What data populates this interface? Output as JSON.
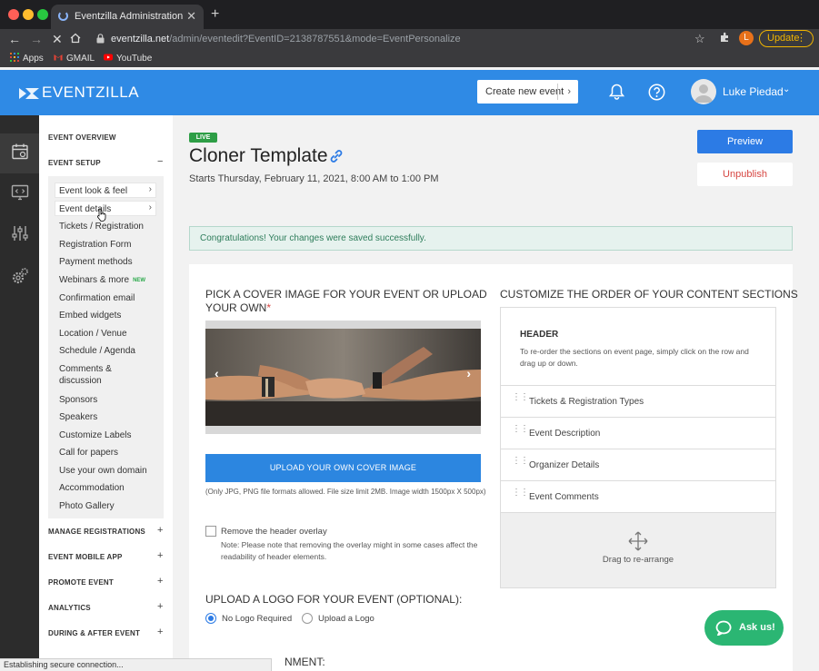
{
  "browser": {
    "tab_title": "Eventzilla Administration",
    "url_host": "eventzilla.net",
    "url_path": "/admin/eventedit?EventID=2138787551&mode=EventPersonalize",
    "profile_initial": "L",
    "update_label": "Update",
    "bookmarks": [
      "Apps",
      "GMAIL",
      "YouTube"
    ],
    "status_text": "Establishing secure connection..."
  },
  "header": {
    "logo_text": "EVENTZILLA",
    "create_event_label": "Create new event",
    "user_name": "Luke Piedad",
    "brand_color": "#2f8ae5"
  },
  "sidebar": {
    "event_overview": "EVENT OVERVIEW",
    "event_setup": "EVENT SETUP",
    "event_setup_toggle": "−",
    "setup_items": [
      "Event look & feel",
      "Event details",
      "Tickets / Registration",
      "Registration Form",
      "Payment methods",
      "Webinars & more",
      "Confirmation email",
      "Embed widgets",
      "Location / Venue",
      "Schedule / Agenda",
      "Comments & discussion",
      "Sponsors",
      "Speakers",
      "Customize Labels",
      "Call for papers",
      "Use your own domain",
      "Accommodation",
      "Photo Gallery"
    ],
    "new_badge": "NEW",
    "sections": [
      {
        "label": "MANAGE REGISTRATIONS",
        "toggle": "+"
      },
      {
        "label": "EVENT MOBILE APP",
        "toggle": "+"
      },
      {
        "label": "PROMOTE EVENT",
        "toggle": "+"
      },
      {
        "label": "ANALYTICS",
        "toggle": "+"
      },
      {
        "label": "DURING & AFTER EVENT",
        "toggle": "+"
      }
    ]
  },
  "event": {
    "status_badge": "LIVE",
    "title": "Cloner Template",
    "date": "Starts Thursday, February 11, 2021, 8:00 AM to 1:00 PM",
    "preview_label": "Preview",
    "unpublish_label": "Unpublish",
    "success_message": "Congratulations! Your changes were saved successfully."
  },
  "cover": {
    "heading": "PICK A COVER IMAGE FOR YOUR EVENT OR UPLOAD YOUR OWN",
    "required_mark": "*",
    "prev_arrow": "‹",
    "next_arrow": "›",
    "upload_label": "UPLOAD YOUR OWN COVER IMAGE",
    "upload_note": "(Only JPG, PNG file formats allowed. File size limit 2MB. Image width 1500px X 500px)",
    "remove_overlay_label": "Remove the header overlay",
    "remove_overlay_checked": false,
    "remove_overlay_note": "Note: Please note that removing the overlay might in some cases affect the readability of header elements."
  },
  "logo_section": {
    "heading": "UPLOAD A LOGO FOR YOUR EVENT (OPTIONAL):",
    "options": [
      "No Logo Required",
      "Upload a Logo"
    ],
    "selected": "No Logo Required"
  },
  "alignment_heading": "NMENT:",
  "order": {
    "heading": "CUSTOMIZE THE ORDER OF YOUR CONTENT SECTIONS",
    "header_title": "HEADER",
    "header_desc": "To re-order the sections on event page, simply click on the row and drag up or down.",
    "rows": [
      "Tickets & Registration Types",
      "Event Description",
      "Organizer Details",
      "Event Comments"
    ],
    "drag_label": "Drag to re-arrange"
  },
  "help": {
    "ask_label": "Ask us!"
  }
}
